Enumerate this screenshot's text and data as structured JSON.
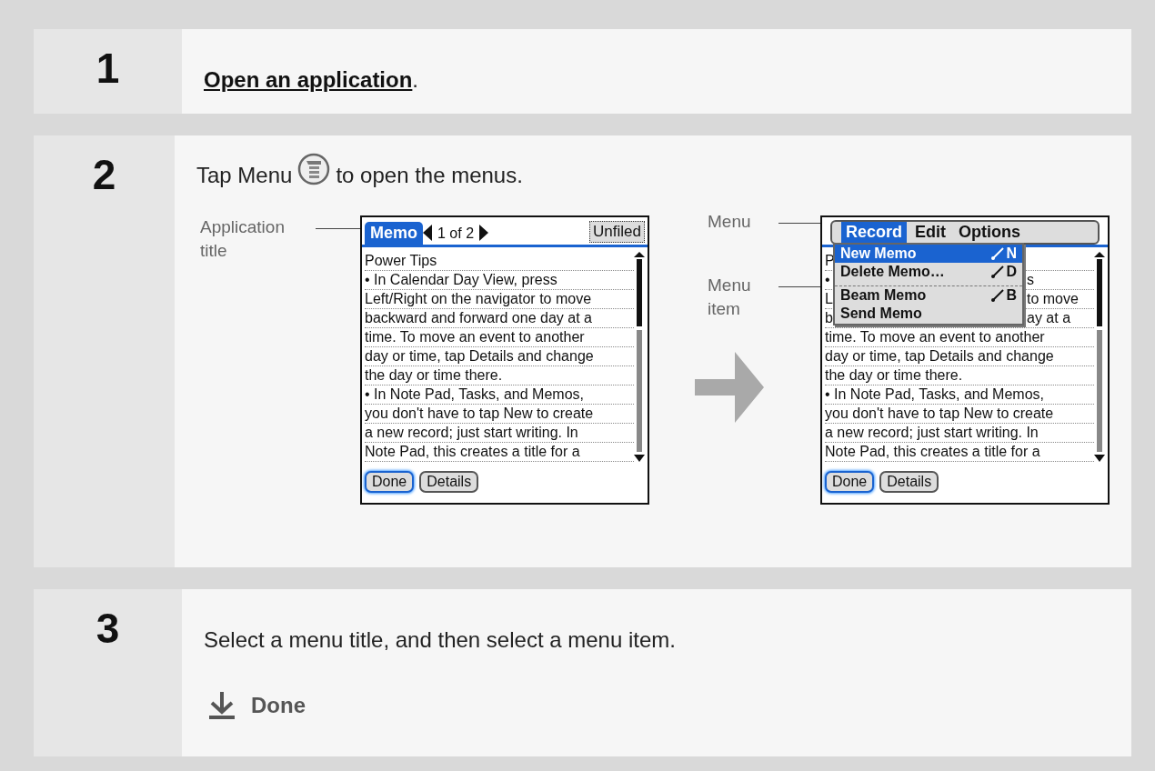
{
  "steps": [
    {
      "number": "1",
      "kind": "link",
      "link": "Open an application",
      "after": "."
    },
    {
      "number": "2",
      "kind": "figure",
      "before": "Tap Menu",
      "after": "to open the menus.",
      "figures": [
        {
          "kind": "memo",
          "callouts": [
            {
              "label": "Application title"
            }
          ],
          "title": "Memo",
          "page": "1 of 2",
          "category": "Unfiled",
          "lines": [
            {
              "start": "Power Tips"
            },
            {
              "start": "• In Calendar Day View, press"
            },
            {
              "start": "Left/Right on the navigator to move"
            },
            {
              "start": "backward and forward one day at a"
            },
            {
              "start": "time. To move an event to another"
            },
            {
              "start": "day or time, tap Details and change"
            },
            {
              "start": "the day or time there."
            },
            {
              "start": "• In Note Pad, Tasks, and Memos,"
            },
            {
              "start": "you don't have to tap New to create"
            },
            {
              "start": "a new record; just start writing. In"
            },
            {
              "start": "Note Pad, this creates a title for a"
            }
          ],
          "buttons": [
            {
              "label": "Done",
              "selected": true
            },
            {
              "label": "Details",
              "selected": false
            }
          ]
        },
        {
          "kind": "menu",
          "callouts": [
            {
              "label": "Menu"
            },
            {
              "label": "Menu item"
            }
          ],
          "menus": [
            {
              "label": "Record",
              "selected": true
            },
            {
              "label": "Edit",
              "selected": false
            },
            {
              "label": "Options",
              "selected": false
            }
          ],
          "menu_items": [
            {
              "label": "New Memo",
              "shortcut": "N",
              "selected": true,
              "divider_above": false
            },
            {
              "label": "Delete Memo…",
              "shortcut": "D",
              "selected": false,
              "divider_above": false
            },
            {
              "label": "Beam Memo",
              "shortcut": "B",
              "selected": false,
              "divider_above": true
            },
            {
              "label": "Send Memo",
              "selected": false,
              "divider_above": false
            }
          ],
          "lines": [
            {
              "start": "P"
            },
            {
              "start": "•",
              "end": "s"
            },
            {
              "start": "L",
              "end": "to move"
            },
            {
              "start": "b",
              "end": "ay at a"
            },
            {
              "start": "time. To move an event to another"
            },
            {
              "start": "day or time, tap Details and change"
            },
            {
              "start": "the day or time there."
            },
            {
              "start": "• In Note Pad, Tasks, and Memos,"
            },
            {
              "start": "you don't have to tap New to create"
            },
            {
              "start": "a new record; just start writing. In"
            },
            {
              "start": "Note Pad, this creates a title for a"
            }
          ],
          "buttons": [
            {
              "label": "Done",
              "selected": true
            },
            {
              "label": "Details",
              "selected": false
            }
          ]
        }
      ]
    },
    {
      "number": "3",
      "kind": "final",
      "text": "Select a menu title, and then select a menu item.",
      "done": "Done"
    }
  ]
}
